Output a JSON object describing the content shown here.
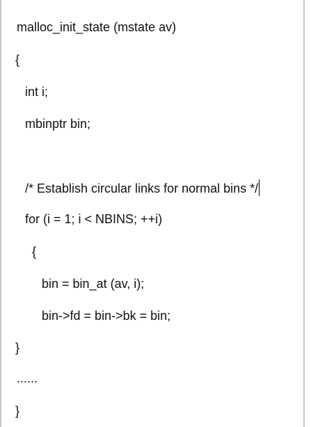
{
  "code": {
    "lines": [
      "malloc_init_state (mstate av)",
      "{",
      "int i;",
      "mbinptr bin;",
      "/* Establish circular links for normal bins */",
      "for (i = 1; i < NBINS; ++i)",
      "{",
      "bin = bin_at (av, i);",
      "bin->fd = bin->bk = bin;",
      "}",
      "......",
      "}"
    ]
  }
}
